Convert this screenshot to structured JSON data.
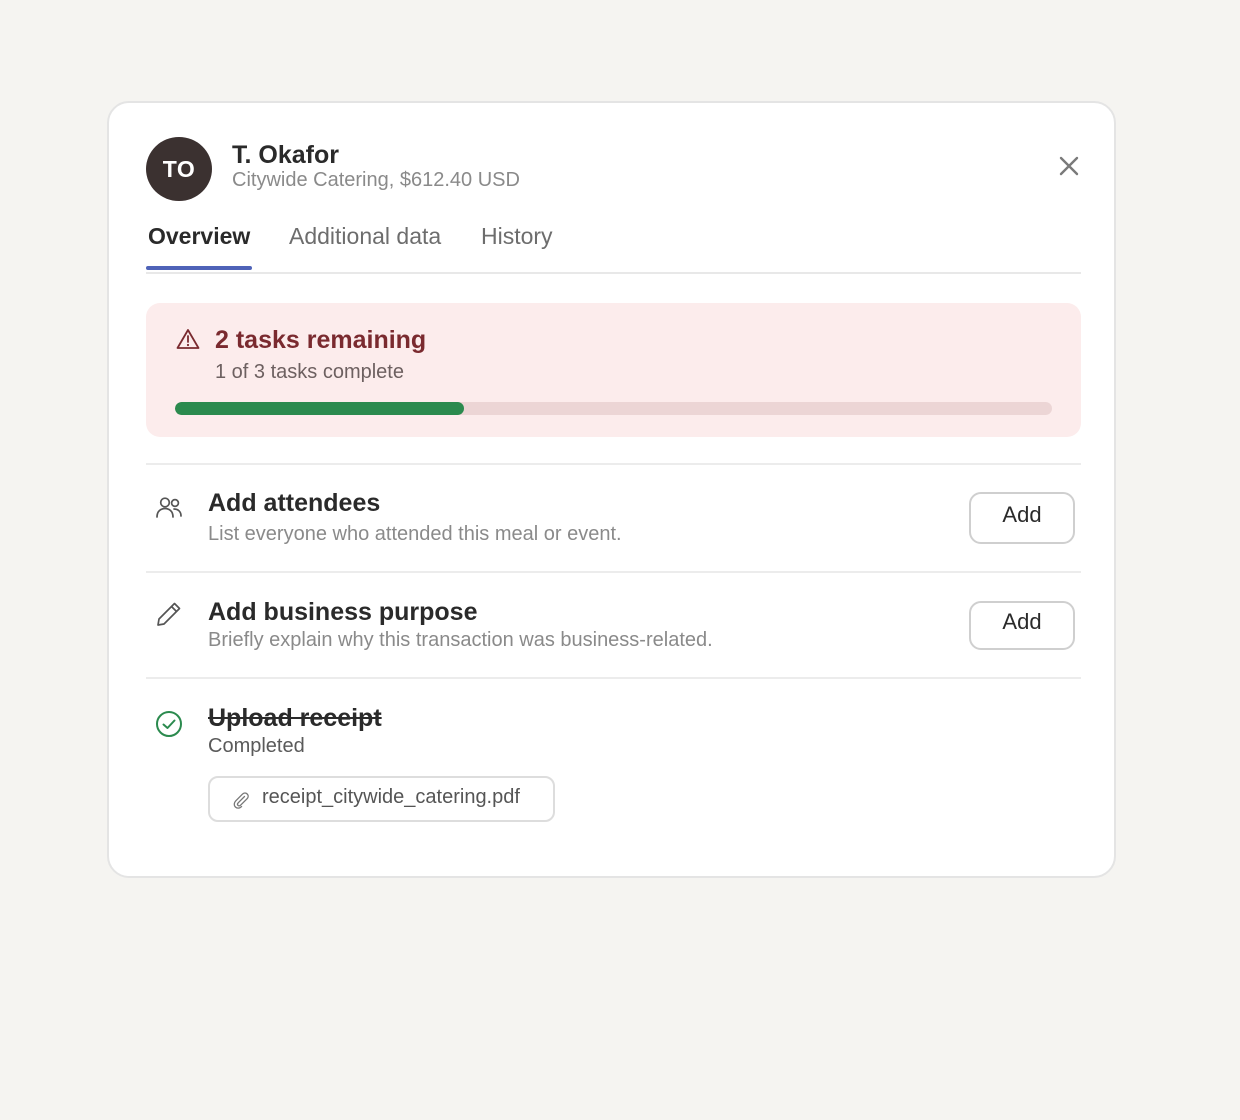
{
  "header": {
    "avatar_initials": "TO",
    "name": "T. Okafor",
    "subtitle": "Citywide Catering, $612.40 USD",
    "close_icon": "close-icon"
  },
  "tabs": [
    {
      "label": "Overview",
      "active": true
    },
    {
      "label": "Additional data",
      "active": false
    },
    {
      "label": "History",
      "active": false
    }
  ],
  "alert": {
    "icon": "warning-triangle-icon",
    "title": "2 tasks remaining",
    "subtitle": "1 of 3 tasks complete",
    "progress_fraction": 0.33,
    "colors": {
      "background": "#fcecec",
      "title": "#7a2a2f",
      "progress_fill": "#2b8a4e",
      "progress_track": "#ecd5d5"
    }
  },
  "tasks": [
    {
      "icon": "people-icon",
      "title": "Add attendees",
      "description": "List everyone who attended this meal or event.",
      "button_label": "Add",
      "completed": false
    },
    {
      "icon": "pencil-icon",
      "title": "Add business purpose",
      "description": "Briefly explain why this transaction was business-related.",
      "button_label": "Add",
      "completed": false
    },
    {
      "icon": "check-circle-icon",
      "title": "Upload receipt",
      "description": "Completed",
      "completed": true,
      "attachment": {
        "icon": "paperclip-icon",
        "filename": "receipt_citywide_catering.pdf"
      }
    }
  ],
  "colors": {
    "accent": "#4f63b8",
    "success": "#2b8a4e",
    "avatar": "#3b3130"
  }
}
